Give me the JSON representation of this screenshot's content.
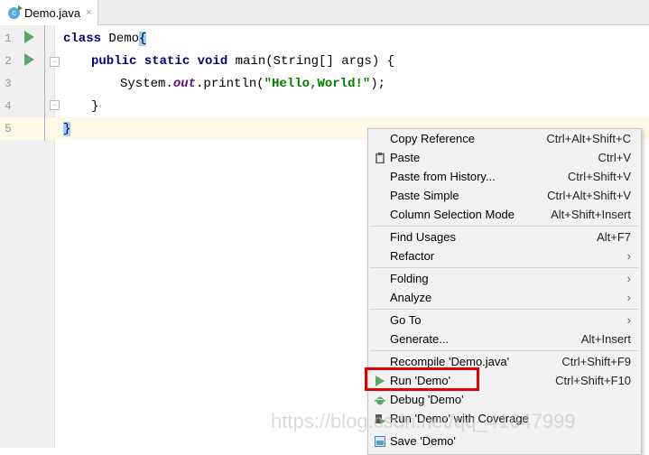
{
  "tab": {
    "title": "Demo.java",
    "icon": "java-class-icon",
    "icon_letter": "c",
    "close": "×"
  },
  "lines": [
    "1",
    "2",
    "3",
    "4",
    "5"
  ],
  "code": {
    "l1": {
      "kw": "class",
      "rest": " Demo",
      "brace": "{"
    },
    "l2": {
      "kw": "public static void",
      "rest": " main(String[] args) {"
    },
    "l3": {
      "pre": "System.",
      "field": "out",
      "mid": ".println(",
      "str": "\"Hello,World!\"",
      "end": ");"
    },
    "l4": "}",
    "l5": "}"
  },
  "menu": [
    {
      "label": "Copy Reference",
      "shortcut": "Ctrl+Alt+Shift+C"
    },
    {
      "label": "Paste",
      "shortcut": "Ctrl+V",
      "icon": "clipboard-icon"
    },
    {
      "label": "Paste from History...",
      "shortcut": "Ctrl+Shift+V"
    },
    {
      "label": "Paste Simple",
      "shortcut": "Ctrl+Alt+Shift+V"
    },
    {
      "label": "Column Selection Mode",
      "shortcut": "Alt+Shift+Insert"
    },
    {
      "label": "Find Usages",
      "shortcut": "Alt+F7"
    },
    {
      "label": "Refactor",
      "submenu": true
    },
    {
      "label": "Folding",
      "submenu": true
    },
    {
      "label": "Analyze",
      "submenu": true
    },
    {
      "label": "Go To",
      "submenu": true
    },
    {
      "label": "Generate...",
      "shortcut": "Alt+Insert"
    },
    {
      "label": "Recompile 'Demo.java'",
      "shortcut": "Ctrl+Shift+F9"
    },
    {
      "label": "Run 'Demo'",
      "shortcut": "Ctrl+Shift+F10",
      "icon": "run-icon",
      "highlighted": true
    },
    {
      "label": "Debug 'Demo'",
      "icon": "debug-icon"
    },
    {
      "label": "Run 'Demo' with Coverage",
      "icon": "coverage-icon"
    },
    {
      "label": "Save 'Demo'",
      "icon": "save-icon"
    }
  ],
  "watermark": "https://blog.csdn.net/qq_41647999",
  "colors": {
    "highlight_box": "#e00000",
    "keyword": "#000080",
    "string": "#008000",
    "run": "#59a869"
  }
}
